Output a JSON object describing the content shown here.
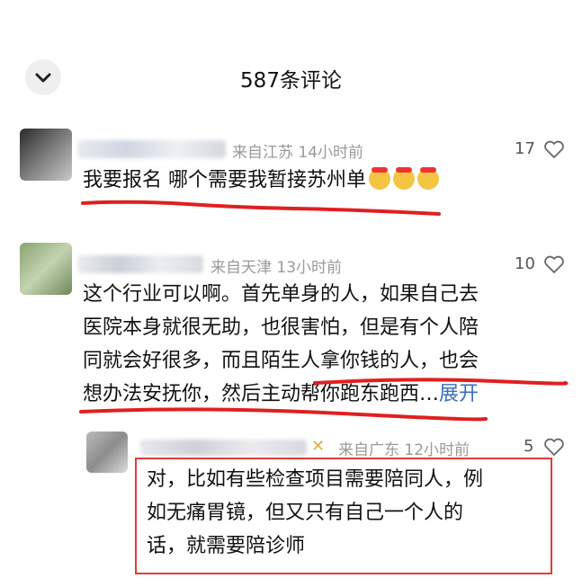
{
  "header": {
    "back_icon": "chevron-down-icon",
    "title": "587条评论"
  },
  "comments": [
    {
      "location_time": "来自江苏 14小时前",
      "likes": "17",
      "text": "我要报名 哪个需要我暂接苏州单"
    },
    {
      "location_time": "来自天津 13小时前",
      "likes": "10",
      "line1": "这个行业可以啊。首先单身的人，如果自己去",
      "line2": "医院本身就很无助，也很害怕，但是有个人陪",
      "line3": "同就会好很多，而且陌生人拿你钱的人，也会",
      "line4": "想办法安抚你，然后主动帮你跑东跑西…",
      "expand": "展开"
    }
  ],
  "reply": {
    "location_time": "来自广东 12小时前",
    "likes": "5",
    "line1": "对，比如有些检查项目需要陪同人，例",
    "line2": "如无痛胃镜，但又只有自己一个人的",
    "line3": "话，就需要陪诊师"
  },
  "colors": {
    "annotation_red": "#e02020",
    "link_blue": "#3a6fb5"
  }
}
